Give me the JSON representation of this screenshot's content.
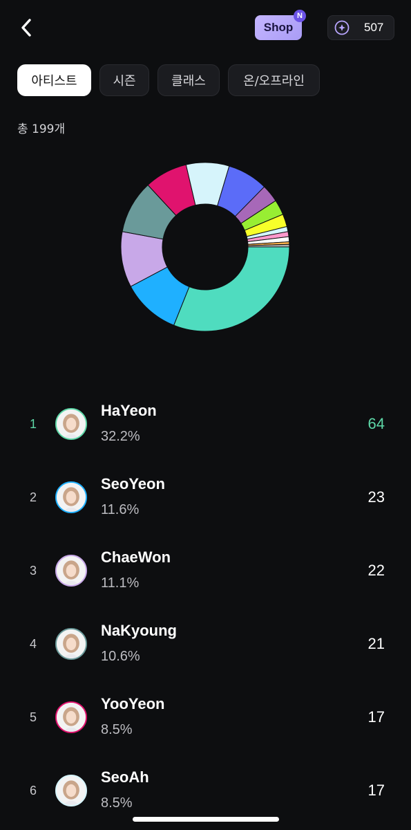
{
  "header": {
    "back_icon": "chevron-left-icon",
    "shop_label": "Shop",
    "shop_badge": "N",
    "points_icon": "compass-icon",
    "points_value": "507"
  },
  "tabs": [
    {
      "label": "아티스트",
      "active": true
    },
    {
      "label": "시즌",
      "active": false
    },
    {
      "label": "클래스",
      "active": false
    },
    {
      "label": "온/오프라인",
      "active": false
    }
  ],
  "total_label": "총 199개",
  "chart_data": {
    "type": "pie",
    "donut": true,
    "values": [
      64,
      23,
      22,
      21,
      17,
      17,
      16,
      7,
      6,
      5,
      2,
      2,
      2,
      1,
      1
    ],
    "colors": [
      "#4fdcbf",
      "#1fb0ff",
      "#c8a8e8",
      "#6a9a9a",
      "#e0136e",
      "#d6f4fb",
      "#5b6cf8",
      "#a768b8",
      "#98ee33",
      "#f7ff2a",
      "#d4f6ff",
      "#ff99cc",
      "#ffffff",
      "#ffb44d",
      "#b0b0b0"
    ]
  },
  "ranking": [
    {
      "rank": "1",
      "name": "HaYeon",
      "percent": "32.2%",
      "count": "64",
      "ring": "#5ed8a8"
    },
    {
      "rank": "2",
      "name": "SeoYeon",
      "percent": "11.6%",
      "count": "23",
      "ring": "#1fb0ff"
    },
    {
      "rank": "3",
      "name": "ChaeWon",
      "percent": "11.1%",
      "count": "22",
      "ring": "#c8a8e8"
    },
    {
      "rank": "4",
      "name": "NaKyoung",
      "percent": "10.6%",
      "count": "21",
      "ring": "#6a9a9a"
    },
    {
      "rank": "5",
      "name": "YooYeon",
      "percent": "8.5%",
      "count": "17",
      "ring": "#e0136e"
    },
    {
      "rank": "6",
      "name": "SeoAh",
      "percent": "8.5%",
      "count": "17",
      "ring": "#d6f4fb"
    }
  ]
}
